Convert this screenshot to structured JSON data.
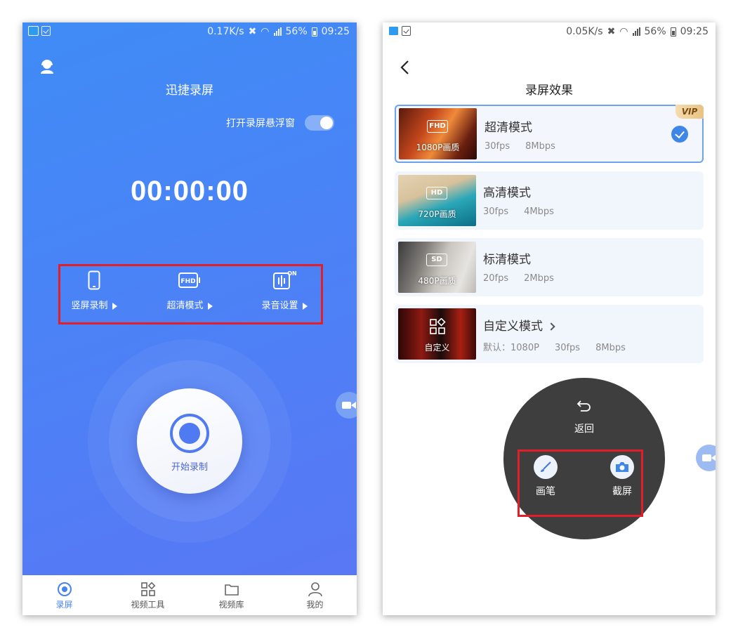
{
  "left_screen": {
    "status_bar": {
      "speed": "0.17K/s",
      "battery": "56%",
      "time": "09:25"
    },
    "header": {
      "title": "迅捷录屏",
      "profile_icon": "user-headset-icon"
    },
    "float_window": {
      "label": "打开录屏悬浮窗",
      "enabled": true
    },
    "timer": "00:00:00",
    "modes": [
      {
        "label": "竖屏录制",
        "icon": "phone-portrait-icon"
      },
      {
        "label": "超清模式",
        "icon": "fhd-icon"
      },
      {
        "label": "录音设置",
        "icon": "microphone-on-icon"
      }
    ],
    "start_button": {
      "label": "开始录制"
    },
    "tabs": [
      {
        "label": "录屏",
        "icon": "record-disc-icon",
        "active": true
      },
      {
        "label": "视频工具",
        "icon": "tools-grid-icon",
        "active": false
      },
      {
        "label": "视频库",
        "icon": "folder-icon",
        "active": false
      },
      {
        "label": "我的",
        "icon": "person-icon",
        "active": false
      }
    ],
    "colors": {
      "gradient_start": "#3f8cf6",
      "gradient_end": "#5a76f5",
      "tab_active": "#4783ef",
      "highlight_box": "#e01f2a"
    }
  },
  "right_screen": {
    "status_bar": {
      "speed": "0.05K/s",
      "battery": "56%",
      "time": "09:25"
    },
    "header": {
      "title": "录屏效果"
    },
    "quality_options": [
      {
        "title": "超清模式",
        "badge": "FHD",
        "thumb_label": "1080P画质",
        "fps": "30fps",
        "bitrate": "8Mbps",
        "vip": "VIP",
        "selected": true
      },
      {
        "title": "高清模式",
        "badge": "HD",
        "thumb_label": "720P画质",
        "fps": "30fps",
        "bitrate": "4Mbps",
        "selected": false
      },
      {
        "title": "标清模式",
        "badge": "SD",
        "thumb_label": "480P画质",
        "fps": "20fps",
        "bitrate": "2Mbps",
        "selected": false
      },
      {
        "title": "自定义模式",
        "thumb_label": "自定义",
        "default_res": "默认：1080P",
        "fps": "30fps",
        "bitrate": "8Mbps",
        "selected": false
      }
    ],
    "floating_menu": {
      "back_label": "返回",
      "brush_label": "画笔",
      "screenshot_label": "截屏"
    },
    "colors": {
      "selected_border": "#6ea3ec",
      "check": "#3e86e8",
      "menu_bg": "#3e3e3e",
      "vip_text": "#7a4b12"
    }
  }
}
